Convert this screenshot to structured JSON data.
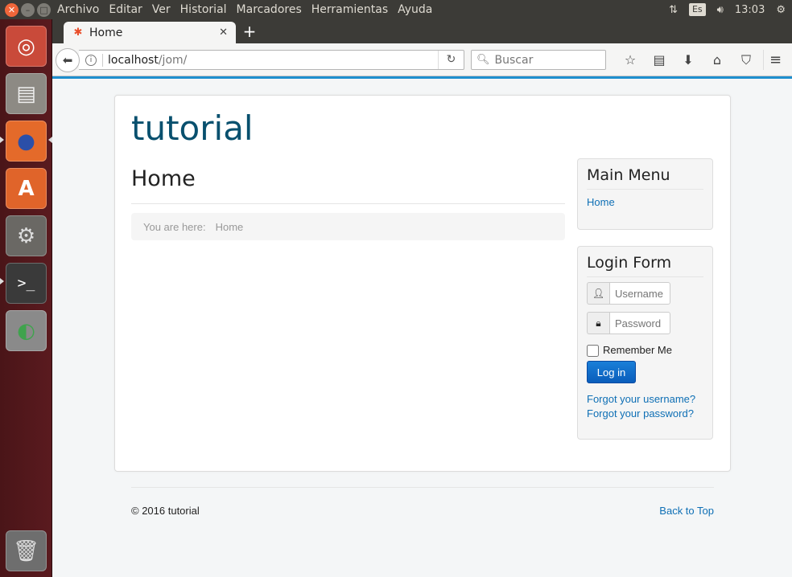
{
  "panel": {
    "menus": [
      "Archivo",
      "Editar",
      "Ver",
      "Historial",
      "Marcadores",
      "Herramientas",
      "Ayuda"
    ],
    "lang": "Es",
    "clock": "13:03"
  },
  "launcher": {
    "items": [
      "ubuntu-dash-icon",
      "files-icon",
      "firefox-icon",
      "software-center-icon",
      "system-settings-icon",
      "terminal-icon",
      "disks-icon",
      "trash-icon"
    ]
  },
  "browser": {
    "tab_title": "Home",
    "url_host": "localhost",
    "url_path": "/jom/",
    "search_placeholder": "Buscar"
  },
  "site": {
    "brand": "tutorial",
    "page_title": "Home",
    "breadcrumb_label": "You are here:",
    "breadcrumb_current": "Home"
  },
  "main_menu": {
    "title": "Main Menu",
    "items": [
      {
        "label": "Home"
      }
    ]
  },
  "login_form": {
    "title": "Login Form",
    "username_placeholder": "Username",
    "password_placeholder": "Password",
    "remember_label": "Remember Me",
    "remember_checked": false,
    "login_button": "Log in",
    "forgot_username": "Forgot your username?",
    "forgot_password": "Forgot your password?"
  },
  "footer": {
    "copyright": "© 2016 tutorial",
    "back_to_top": "Back to Top"
  },
  "colors": {
    "brand": "#08506e",
    "link": "#0e6fb5",
    "button": "#0a5dbb",
    "accent": "#1e8fce"
  }
}
